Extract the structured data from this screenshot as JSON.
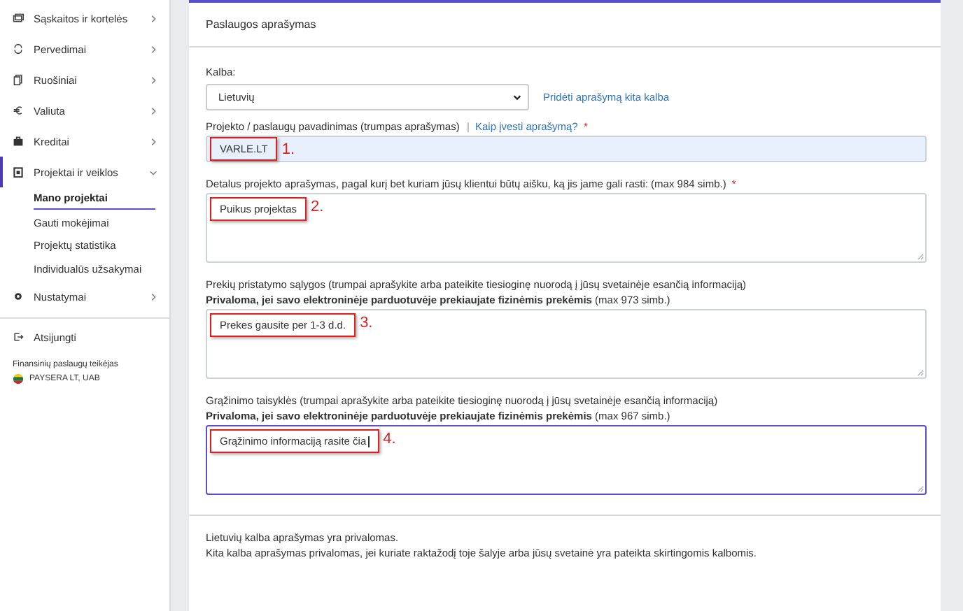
{
  "sidebar": {
    "items": [
      {
        "label": "Sąskaitos ir kortelės",
        "expanded": false
      },
      {
        "label": "Pervedimai",
        "expanded": false
      },
      {
        "label": "Ruošiniai",
        "expanded": false
      },
      {
        "label": "Valiuta",
        "expanded": false
      },
      {
        "label": "Kreditai",
        "expanded": false
      },
      {
        "label": "Projektai ir veiklos",
        "expanded": true,
        "children": [
          {
            "label": "Mano projektai",
            "selected": true
          },
          {
            "label": "Gauti mokėjimai",
            "selected": false
          },
          {
            "label": "Projektų statistika",
            "selected": false
          },
          {
            "label": "Individualūs užsakymai",
            "selected": false
          }
        ]
      },
      {
        "label": "Nustatymai",
        "expanded": false
      }
    ],
    "logout": "Atsijungti",
    "provider_label": "Finansinių paslaugų teikėjas",
    "provider_name": "PAYSERA LT, UAB"
  },
  "card": {
    "title": "Paslaugos aprašymas",
    "language": {
      "label": "Kalba:",
      "value": "Lietuvių",
      "link": "Pridėti aprašymą kita kalba"
    },
    "fields": [
      {
        "kind": "input",
        "label": "Projekto / paslaugų pavadinimas (trumpas aprašymas)",
        "separator": "|",
        "help_link": "Kaip įvesti aprašymą?",
        "required_mark": "*",
        "value": "VARLE.LT",
        "annotation": "1.",
        "focused": false
      },
      {
        "kind": "textarea",
        "label": "Detalus projekto aprašymas, pagal kurį bet kuriam jūsų klientui būtų aišku, ką jis jame gali rasti: (max 984 simb.)",
        "required_mark": "*",
        "value": "Puikus projektas",
        "annotation": "2.",
        "focused": false
      },
      {
        "kind": "textarea",
        "label": "Prekių pristatymo sąlygos (trumpai aprašykite arba pateikite tiesioginę nuorodą į jūsų svetainėje esančią informaciją)",
        "note": "**Privaloma, jei savo elektroninėje parduotuvėje prekiaujate fizinėmis prekėmis** (max 973 simb.)",
        "value": "Prekes gausite per 1-3 d.d.",
        "annotation": "3.",
        "focused": false
      },
      {
        "kind": "textarea",
        "label": "Grąžinimo taisyklės (trumpai aprašykite arba pateikite tiesioginę nuorodą į jūsų svetainėje esančią informaciją)",
        "note": "**Privaloma, jei savo elektroninėje parduotuvėje prekiaujate fizinėmis prekėmis** (max 967 simb.)",
        "value": "Grąžinimo informaciją rasite čia",
        "annotation": "4.",
        "focused": true
      }
    ],
    "footer": [
      "Lietuvių kalba aprašymas yra privalomas.",
      "Kita kalba aprašymas privalomas, jei kuriate raktažodį toje šalyje arba jūsų svetainė yra pateikta skirtingomis kalbomis."
    ]
  }
}
